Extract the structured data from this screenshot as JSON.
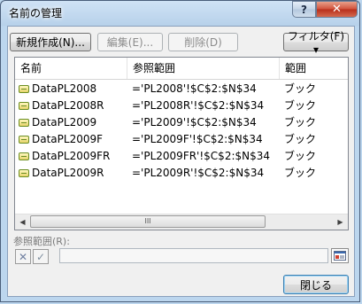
{
  "window": {
    "title": "名前の管理",
    "help_label": "?",
    "close_label": "✕"
  },
  "toolbar": {
    "new_label": "新規作成(N)...",
    "edit_label": "編集(E)...",
    "delete_label": "削除(D)",
    "filter_label": "フィルタ(F) ▾"
  },
  "list": {
    "columns": [
      "名前",
      "参照範囲",
      "範囲"
    ],
    "rows": [
      {
        "name": "DataPL2008",
        "ref": "='PL2008'!$C$2:$N$34",
        "scope": "ブック"
      },
      {
        "name": "DataPL2008R",
        "ref": "='PL2008R'!$C$2:$N$34",
        "scope": "ブック"
      },
      {
        "name": "DataPL2009",
        "ref": "='PL2009'!$C$2:$N$34",
        "scope": "ブック"
      },
      {
        "name": "DataPL2009F",
        "ref": "='PL2009F'!$C$2:$N$34",
        "scope": "ブック"
      },
      {
        "name": "DataPL2009FR",
        "ref": "='PL2009FR'!$C$2:$N$34",
        "scope": "ブック"
      },
      {
        "name": "DataPL2009R",
        "ref": "='PL2009R'!$C$2:$N$34",
        "scope": "ブック"
      }
    ],
    "scroll": {
      "left_icon": "◀",
      "right_icon": "▶",
      "thumb_grip": "III"
    }
  },
  "reference": {
    "label": "参照範囲(R):",
    "value": "",
    "cancel_icon": "✕",
    "confirm_icon": "✓"
  },
  "footer": {
    "close_label": "閉じる"
  },
  "colors": {
    "accent": "#3c7fb1",
    "title_close": "#c0392b"
  }
}
